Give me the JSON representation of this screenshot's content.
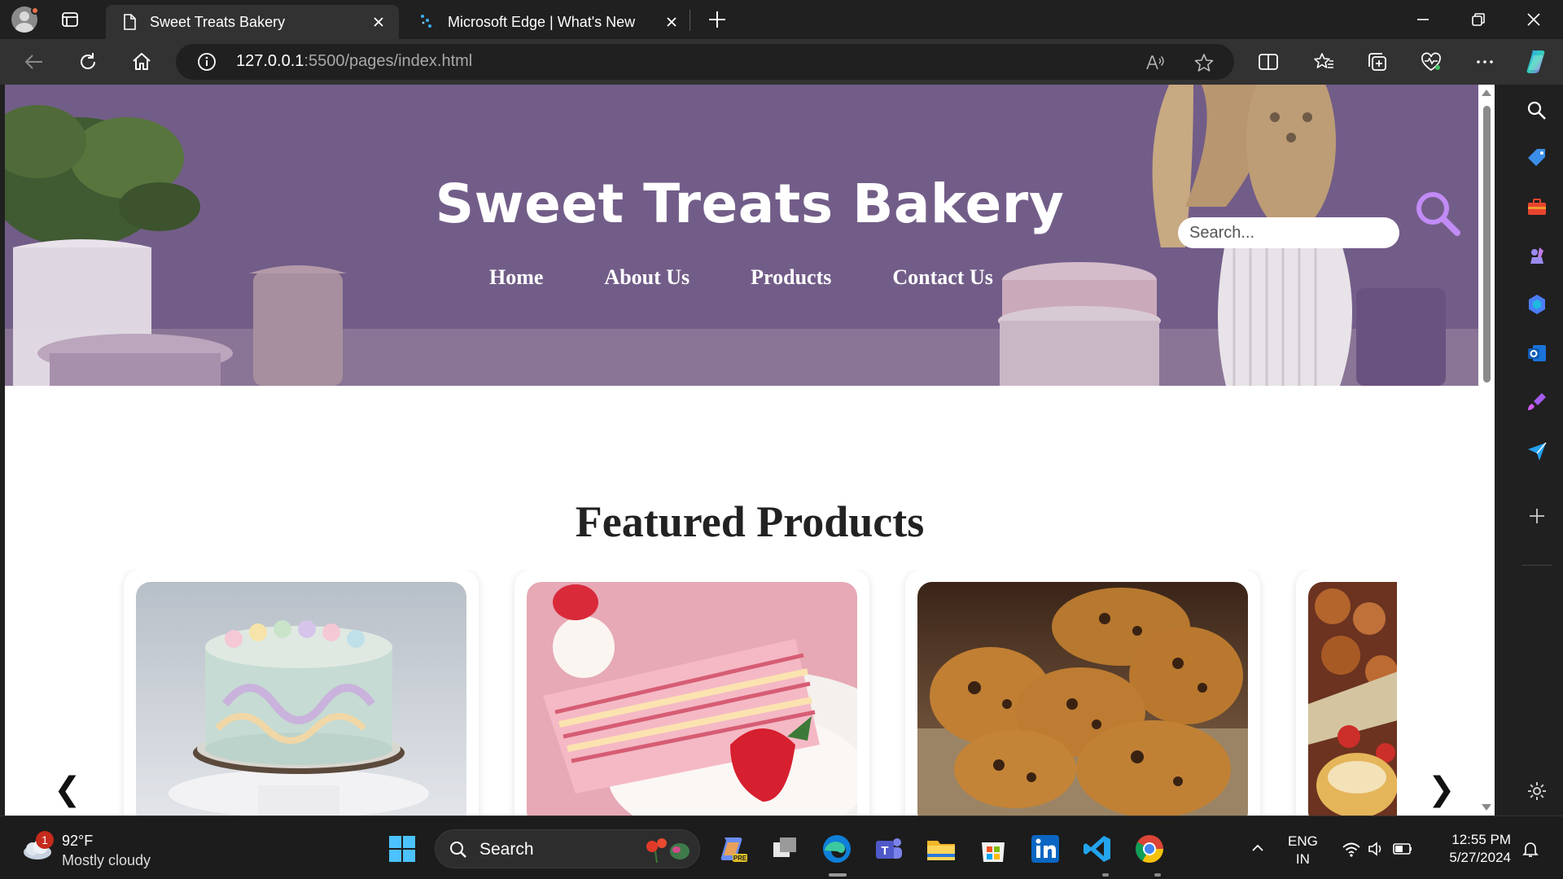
{
  "browser": {
    "tabs": [
      {
        "title": "Sweet Treats Bakery",
        "active": true
      },
      {
        "title": "Microsoft Edge | What's New",
        "active": false
      }
    ],
    "url_host": "127.0.0.1",
    "url_rest": ":5500/pages/index.html"
  },
  "site": {
    "title": "Sweet Treats Bakery",
    "nav": [
      "Home",
      "About Us",
      "Products",
      "Contact Us"
    ],
    "search_placeholder": "Search...",
    "featured_title": "Featured Products",
    "products": [
      {
        "image": "pastel-swirl-frosted-cake"
      },
      {
        "image": "strawberry-layer-cake-slice"
      },
      {
        "image": "chocolate-chip-cookies"
      },
      {
        "image": "assorted-pastries"
      }
    ],
    "prev_arrow": "❮",
    "next_arrow": "❯"
  },
  "taskbar": {
    "weather_badge": "1",
    "temperature": "92°F",
    "condition": "Mostly cloudy",
    "search_label": "Search",
    "lang_1": "ENG",
    "lang_2": "IN",
    "time": "12:55 PM",
    "date": "5/27/2024"
  },
  "colors": {
    "hero_purple": "#755f8c",
    "browser_dark": "#202020",
    "accent_search": "#c28bf5"
  }
}
